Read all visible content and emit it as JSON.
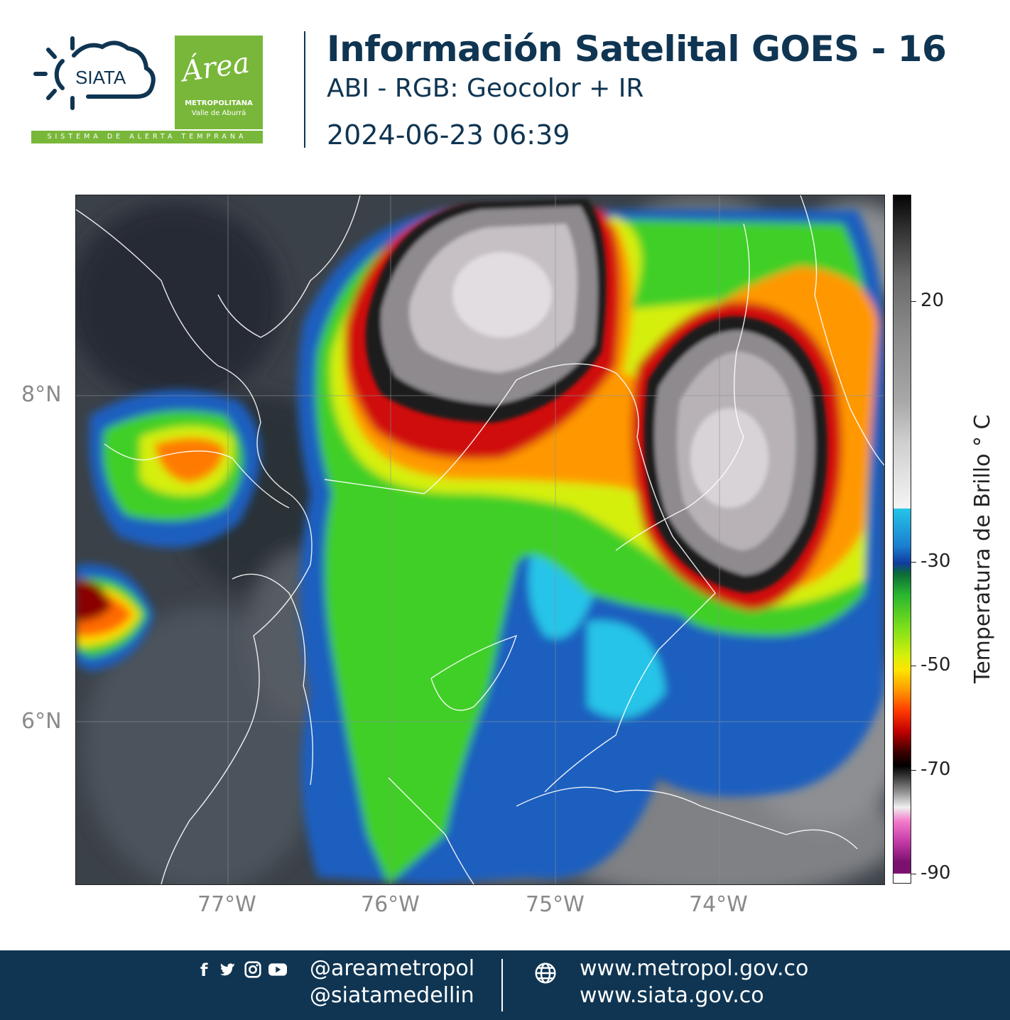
{
  "header": {
    "logo_siata_text": "SIATA",
    "logo_area_script": "Área",
    "logo_area_name1": "METROPOLITANA",
    "logo_area_name2": "Valle de Aburrá",
    "logo_banner": "SISTEMA DE ALERTA TEMPRANA",
    "title": "Información Satelital GOES - 16",
    "subtitle": "ABI - RGB: Geocolor + IR",
    "timestamp": "2024-06-23 06:39"
  },
  "map": {
    "lat_labels": [
      "8°N",
      "6°N"
    ],
    "lon_labels": [
      "77°W",
      "76°W",
      "75°W",
      "74°W"
    ]
  },
  "colorbar": {
    "title": "Temperatura de Brillo ° C",
    "tick_labels": [
      "20",
      "-30",
      "-50",
      "-70",
      "-90"
    ],
    "colors": {
      "warm_gray": "#a8a8a8",
      "cyan": "#25c4e8",
      "blue": "#123b9e",
      "green": "#27b52f",
      "yellow": "#ffe400",
      "orange": "#ff9800",
      "red": "#c00000",
      "black": "#000000",
      "pink": "#f27ccb",
      "purple": "#7b1070"
    }
  },
  "footer": {
    "social_handle_1": "@areametropol",
    "social_handle_2": "@siatamedellin",
    "web_1": "www.metropol.gov.co",
    "web_2": "www.siata.gov.co",
    "icons": [
      "facebook-icon",
      "twitter-icon",
      "instagram-icon",
      "youtube-icon",
      "globe-icon"
    ]
  }
}
